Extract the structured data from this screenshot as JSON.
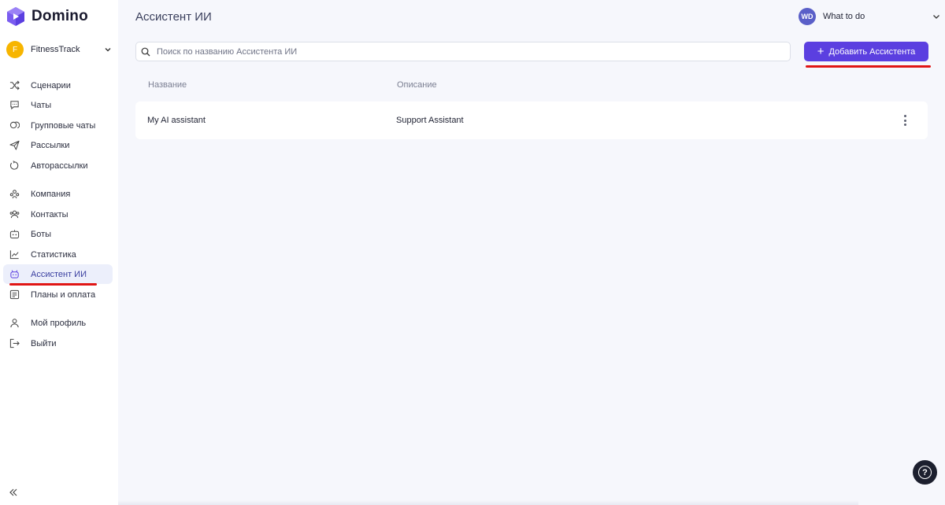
{
  "app": {
    "name": "Domino",
    "brand_color": "#5b3fe0"
  },
  "workspace": {
    "initial": "F",
    "name": "FitnessTrack",
    "avatar_color": "#f7b500"
  },
  "sidebar": {
    "groups": [
      [
        {
          "label": "Сценарии",
          "icon": "shuffle-icon"
        },
        {
          "label": "Чаты",
          "icon": "chat-bubble-icon"
        },
        {
          "label": "Групповые чаты",
          "icon": "group-chat-icon"
        },
        {
          "label": "Рассылки",
          "icon": "send-icon"
        },
        {
          "label": "Авторассылки",
          "icon": "auto-repeat-icon"
        }
      ],
      [
        {
          "label": "Компания",
          "icon": "company-icon"
        },
        {
          "label": "Контакты",
          "icon": "contacts-icon"
        },
        {
          "label": "Боты",
          "icon": "bot-icon"
        },
        {
          "label": "Статистика",
          "icon": "chart-icon"
        },
        {
          "label": "Ассистент ИИ",
          "icon": "ai-assistant-icon",
          "active": true
        },
        {
          "label": "Планы и оплата",
          "icon": "billing-icon"
        }
      ],
      [
        {
          "label": "Мой профиль",
          "icon": "user-icon"
        },
        {
          "label": "Выйти",
          "icon": "logout-icon"
        }
      ]
    ],
    "collapse_icon": "double-chevron-left-icon"
  },
  "header": {
    "title": "Ассистент ИИ",
    "user": {
      "initials": "WD",
      "name": "What to do",
      "avatar_color": "#5a5fc8"
    }
  },
  "toolbar": {
    "search_placeholder": "Поиск по названию Ассистента ИИ",
    "search_value": "",
    "add_button_label": "Добавить Ассистента",
    "add_button_icon": "plus-icon"
  },
  "table": {
    "columns": [
      "Название",
      "Описание"
    ],
    "rows": [
      {
        "name": "My AI assistant",
        "description": "Support Assistant",
        "menu_icon": "more-vertical-icon"
      }
    ]
  },
  "help": {
    "icon": "help-icon",
    "glyph": "?"
  },
  "highlight_color": "#e01515"
}
